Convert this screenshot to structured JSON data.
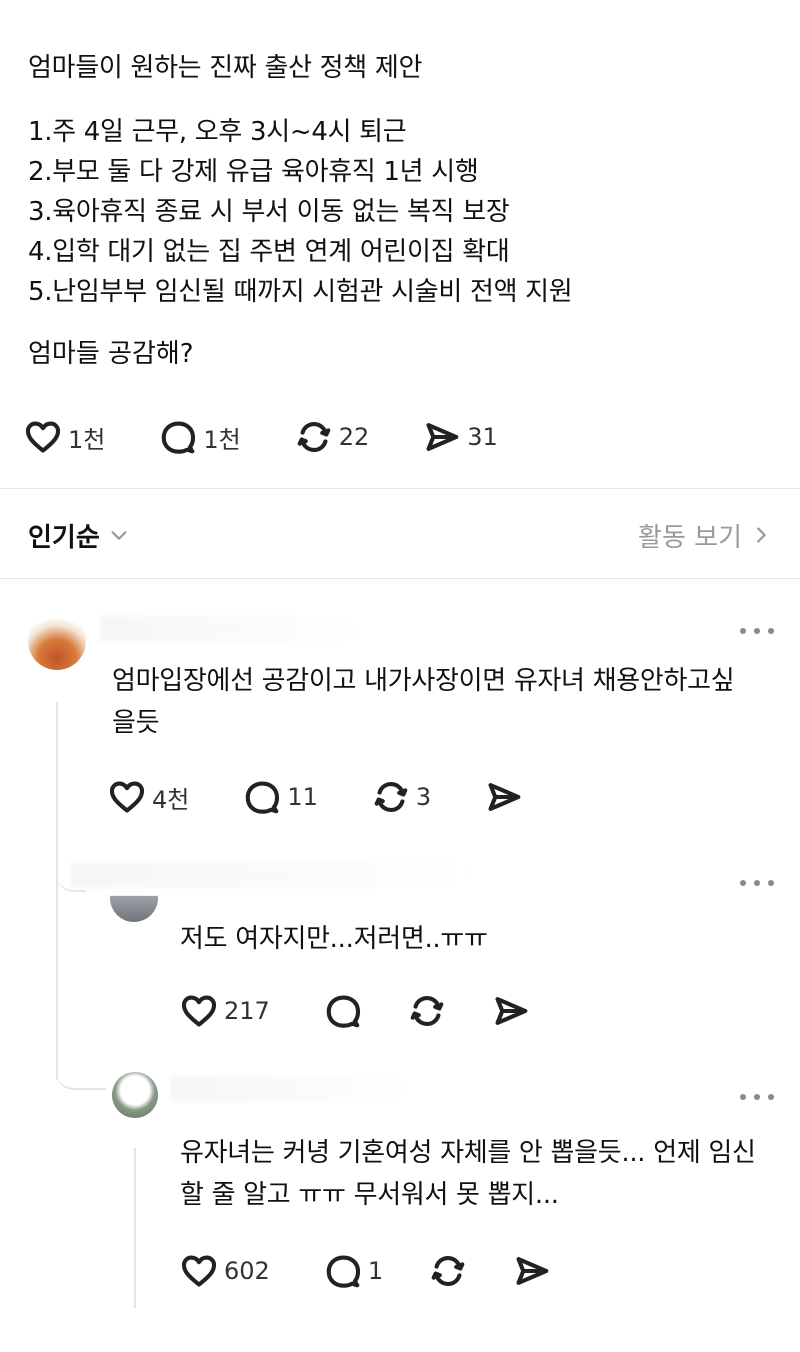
{
  "post": {
    "title": "엄마들이 원하는 진짜 출산 정책 제안",
    "items": [
      "1.주 4일 근무, 오후 3시~4시 퇴근",
      "2.부모 둘 다 강제 유급 육아휴직 1년 시행",
      "3.육아휴직 종료 시 부서 이동 없는 복직 보장",
      "4.입학 대기 없는 집 주변 연계 어린이집 확대",
      "5.난임부부 임신될 때까지 시험관 시술비 전액 지원"
    ],
    "question": "엄마들 공감해?",
    "stats": {
      "likes": "1천",
      "replies": "1천",
      "reposts": "22",
      "shares": "31"
    }
  },
  "sort": {
    "label": "인기순",
    "activity_label": "활동 보기"
  },
  "comments": [
    {
      "text": "엄마입장에선 공감이고 내가사장이면 유자녀 채용안하고싶을듯",
      "stats": {
        "likes": "4천",
        "replies": "11",
        "reposts": "3",
        "shares": ""
      }
    },
    {
      "text": "저도 여자지만...저러면..ㅠㅠ",
      "stats": {
        "likes": "217",
        "replies": "",
        "reposts": "",
        "shares": ""
      }
    },
    {
      "text": "유자녀는 커녕 기혼여성 자체를 안 뽑을듯... 언제 임신할 줄 알고 ㅠㅠ 무서워서 못 뽑지...",
      "stats": {
        "likes": "602",
        "replies": "1",
        "reposts": "",
        "shares": ""
      }
    }
  ],
  "icons": {
    "like": "heart-icon",
    "reply": "speech-bubble-icon",
    "repost": "repost-icon",
    "share": "send-icon",
    "more": "more-dots-icon",
    "sort": "chevron-down-icon",
    "activity": "chevron-right-icon"
  },
  "colors": {
    "text": "#111111",
    "muted": "#9a9a9a",
    "divider": "#e6e6e6"
  }
}
